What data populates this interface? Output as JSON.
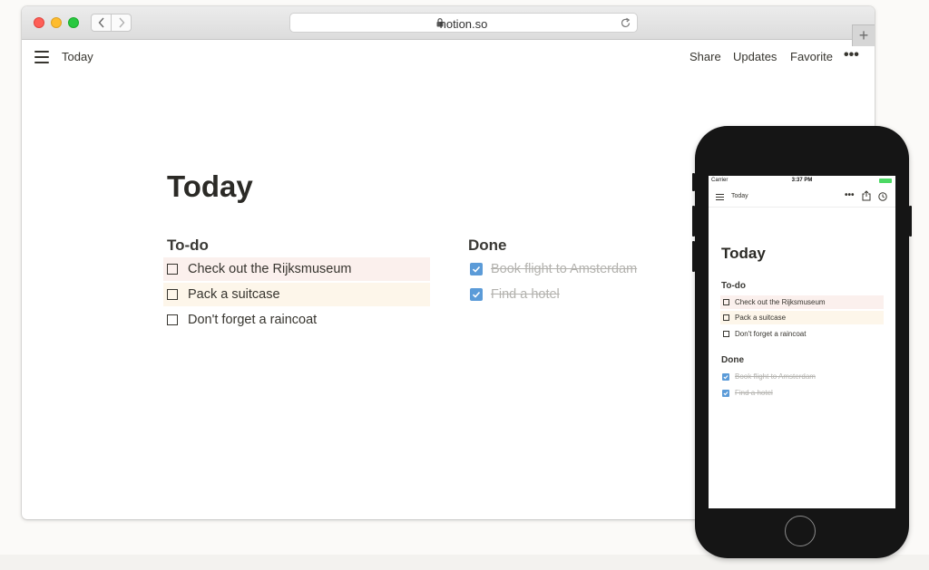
{
  "browser": {
    "url": "notion.so",
    "back_icon": "chevron-left-icon",
    "forward_icon": "chevron-right-icon",
    "lock_icon": "lock-icon",
    "reload_icon": "reload-icon",
    "new_tab_label": "+"
  },
  "topbar": {
    "breadcrumb": "Today",
    "share_label": "Share",
    "updates_label": "Updates",
    "favorite_label": "Favorite",
    "more_label": "•••"
  },
  "page": {
    "title": "Today",
    "todo_heading": "To-do",
    "done_heading": "Done",
    "todo_items": [
      {
        "text": "Check out the Rijksmuseum",
        "checked": false,
        "highlight": "#fbf0ed"
      },
      {
        "text": "Pack a suitcase",
        "checked": false,
        "highlight": "#fdf6ea"
      },
      {
        "text": "Don't forget a raincoat",
        "checked": false,
        "highlight": ""
      }
    ],
    "done_items": [
      {
        "text": "Book flight to Amsterdam",
        "checked": true
      },
      {
        "text": "Find a hotel",
        "checked": true
      }
    ]
  },
  "phone": {
    "carrier": "Carrier",
    "time": "3:37 PM",
    "breadcrumb": "Today",
    "more_label": "•••",
    "title": "Today",
    "todo_heading": "To-do",
    "done_heading": "Done",
    "todo_items": [
      {
        "text": "Check out the Rijksmuseum",
        "highlight": "#fbf0ed"
      },
      {
        "text": "Pack a suitcase",
        "highlight": "#fdf6ea"
      },
      {
        "text": "Don't forget a raincoat",
        "highlight": ""
      }
    ],
    "done_items": [
      {
        "text": "Book flight to Amsterdam"
      },
      {
        "text": "Find a hotel"
      }
    ]
  },
  "colors": {
    "accent_checkbox": "#5b9bd8",
    "text": "#37352f",
    "done_text": "#b3b2ae"
  }
}
